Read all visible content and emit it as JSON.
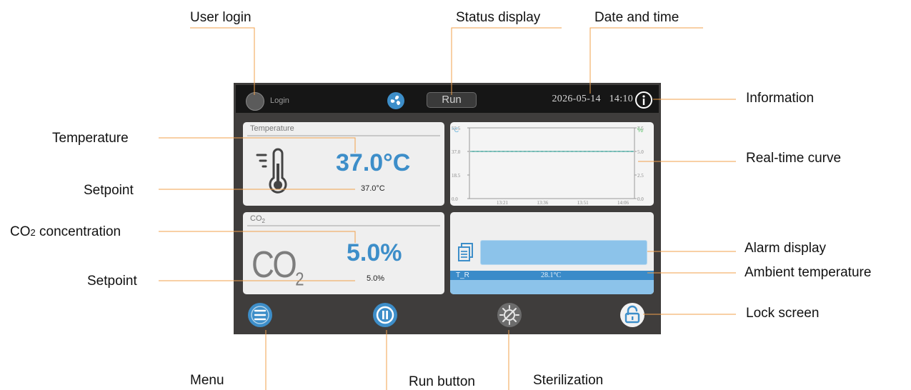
{
  "annotations": {
    "user_login": "User login",
    "status_display": "Status display",
    "date_and_time": "Date and time",
    "information": "Information",
    "temperature": "Temperature",
    "realtime_curve": "Real-time curve",
    "setpoint_temp": "Setpoint",
    "co2_concentration_prefix": "CO",
    "co2_concentration_sub": "2",
    "co2_concentration_suffix": " concentration",
    "setpoint_co2": "Setpoint",
    "alarm_display": "Alarm display",
    "ambient_temperature": "Ambient temperature",
    "lock_screen": "Lock screen",
    "menu": "Menu",
    "run_button": "Run button",
    "sterilization": "Sterilization"
  },
  "screen": {
    "login_label": "Login",
    "status": "Run",
    "date": "2026-05-14",
    "time": "14:10",
    "temperature_panel": {
      "title": "Temperature",
      "value": "37.0°C",
      "setpoint": "37.0°C"
    },
    "co2_panel": {
      "title_main": "CO",
      "title_sub": "2",
      "glyph_main": "CO",
      "glyph_sub": "2",
      "value": "5.0%",
      "setpoint": "5.0%"
    },
    "ambient": {
      "label": "T_R",
      "value": "28.1°C"
    }
  },
  "colors": {
    "accent_blue": "#3d8ec9",
    "screen_bg": "#3f3d3c",
    "leader_line": "#f0a04b",
    "curve_line": "#4aa8a0",
    "alarm_bar": "#8cc3ea"
  },
  "icons": {
    "fan": "fan-icon",
    "info": "info-icon",
    "thermometer": "thermometer-icon",
    "document": "document-icon",
    "menu": "hamburger-icon",
    "run": "pause-icon",
    "sterilization": "sterilization-icon",
    "lock": "unlocked-padlock-icon"
  },
  "chart_data": {
    "type": "line",
    "x": [
      "13:21",
      "13:36",
      "13:51",
      "14:06"
    ],
    "left_axis": {
      "unit": "°C",
      "ticks": [
        "55.5",
        "37.0",
        "18.5",
        "0.0"
      ],
      "ylim": [
        0,
        55.5
      ]
    },
    "right_axis": {
      "unit": "%",
      "ticks": [
        "7.5",
        "5.0",
        "2.5",
        "0.0"
      ],
      "ylim": [
        0,
        7.5
      ]
    },
    "series": [
      {
        "axis": "left",
        "values": [
          37.0,
          37.0,
          37.0,
          37.0
        ]
      },
      {
        "axis": "right",
        "values": [
          5.0,
          5.0,
          5.0,
          5.0
        ]
      }
    ],
    "grid": false
  }
}
